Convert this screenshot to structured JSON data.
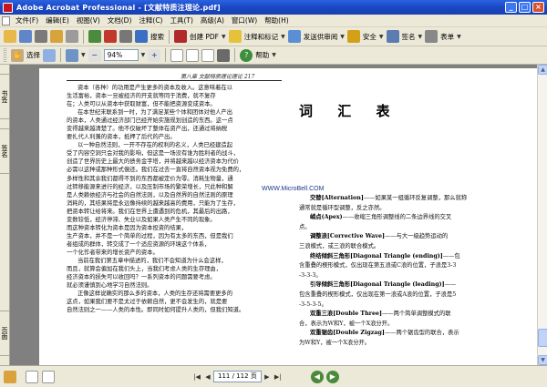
{
  "window": {
    "title": "Adobe Acrobat Professional - [文献特质注理论.pdf]",
    "buttons": [
      "_",
      "□",
      "×"
    ]
  },
  "menu": {
    "items": [
      "文件(F)",
      "编辑(E)",
      "视图(V)",
      "文档(D)",
      "注释(C)",
      "工具(T)",
      "高级(A)",
      "窗口(W)",
      "帮助(H)"
    ]
  },
  "toolbar1": {
    "search_label": "搜索",
    "create_pdf_label": "创建 PDF",
    "review_label": "注释和标记",
    "send_review_label": "发送供审阅",
    "secure_label": "安全",
    "sign_label": "签名",
    "forms_label": "表单"
  },
  "toolbar2": {
    "select_label": "选择",
    "zoom_value": "94%",
    "help_label": "帮助"
  },
  "left_tabs": [
    "书签",
    "签名",
    "页面"
  ],
  "page": {
    "running_head": "第八章  文献特质理论理论  217",
    "left_column": [
      {
        "text": "资本（各种）的功用是产生更多的资本及收入。这意味着在以",
        "indent": true
      },
      {
        "text": "生活富裕，资本一旦被经济的开支就等同于消费，就不复存",
        "indent": false
      },
      {
        "text": "在；人类可以从资本中获取财富，但不能把资源变成资本。",
        "indent": false
      },
      {
        "text": "在本世纪末联系到一时，为了满足某些个体和团体对他人产出",
        "indent": true
      },
      {
        "text": "的资本，人类通过经济部门已经开始实施规划创造的东西。这一点",
        "indent": false
      },
      {
        "text": "变得越来越清楚了。他不仅破坏了整体在资产出，还通过将纳税",
        "indent": false
      },
      {
        "text": "要扎代人利兼的资本，抵押了后代的产出。",
        "indent": false
      },
      {
        "text": "以一种自然法则，一开不存在的权利的名义，人类已经建造起",
        "indent": true
      },
      {
        "text": "受了内容空洞只会对我的影响，但这是一场没有谁为胜利者的战斗，",
        "indent": false
      },
      {
        "text": "创造了世界历史上最大的债务金字塔，并将越来越以经济资本为代价",
        "indent": false
      },
      {
        "text": "必需以这种或那种形式偿还。我们在过去一直将自然资本视为免费的，",
        "indent": false
      },
      {
        "text": "多样性和其余我们都得不到的东西都被定价为零。消耗生物量，通",
        "indent": false
      },
      {
        "text": "过转移能源来进行的经济，以及压制市场的繁荣增长，只此种和解",
        "indent": false
      },
      {
        "text": "是人类赖依经济与社会的自然法则，以及自然界的自然法则的原理",
        "indent": false
      },
      {
        "text": "消耗的，其结果将是永远像持续的越来越高的费用，只能为了生存，",
        "indent": false
      },
      {
        "text": "把资本转让给将来。我们在世界上遭遇到的危机，其最后的出路，",
        "indent": false
      },
      {
        "text": "变数较低，经济停滞、失业以及如果人类产生不同的现象。",
        "indent": false
      },
      {
        "text": "而这种资本转化为资本是因为资本投资的结果，",
        "indent": false
      },
      {
        "text": "生产资本，并不是一个简单的过程，因为有太多的东西，但是我们",
        "indent": false
      },
      {
        "text": "者组成的群体，转交成了一个适应资源的环境这个体系，",
        "indent": false
      },
      {
        "text": "一个化作者带来的增长资产的资本。",
        "indent": false
      },
      {
        "text": "当前在我们第五章中描述的，我们不会知道为什么会这样，",
        "indent": true
      },
      {
        "text": "而且，就算会偏加在我们头上，当我们考虑人类的生存理由，",
        "indent": false
      },
      {
        "text": "经济资本的损失可以收回吗？一系列资本的问题需要考虑。",
        "indent": false
      },
      {
        "text": "就必须谨慎到心地学习自然法则。",
        "indent": false
      },
      {
        "text": "正像这样说确实的那么多的资本，人类的生存还将需要更多的",
        "indent": true
      },
      {
        "text": "这点，如果我们要不是太过于依赖自然，更不会发生的，就是要",
        "indent": false
      },
      {
        "text": "自然法则之一——人类的本性。即同时如何提升人类的，但我们知道。",
        "indent": false
      }
    ],
    "watermark": "WWW.MicroBell.COM",
    "glossary_title": "词 汇 表",
    "glossary": [
      {
        "term": "交替[Alternation]",
        "def": "——如果某一组循环反复调整，那么就称",
        "indent": true
      },
      {
        "term": "",
        "def": "通常就是循环型调整，反之亦然。",
        "indent": false
      },
      {
        "term": "峭点(Apex)",
        "def": "——收缩三角形调整线的二条边界线的交叉",
        "indent": true
      },
      {
        "term": "",
        "def": "点。",
        "indent": false
      },
      {
        "term": "调整浪[Corrective Wave]",
        "def": "——与大一级趋势运动的",
        "indent": true
      },
      {
        "term": "",
        "def": "三浪模式，或三浪的联合模式。",
        "indent": false
      },
      {
        "term": "终结倾斜三角形[Diagonal Triangle (ending)]",
        "def": "——包",
        "indent": true
      },
      {
        "term": "",
        "def": "含重叠的楔形模式，仅出现在第五浪或C浪的位置，子浪是3-3",
        "indent": false
      },
      {
        "term": "",
        "def": "-3-3-3。",
        "indent": false
      },
      {
        "term": "引导倾斜三角形[Diagonal Triangle (leading)]",
        "def": "——",
        "indent": true
      },
      {
        "term": "",
        "def": "包含重叠的楔形模式，仅出现在第一浪或A浪的位置，子浪是5",
        "indent": false
      },
      {
        "term": "",
        "def": "-3-5-3-5。",
        "indent": false
      },
      {
        "term": "双重三浪[Double Three]",
        "def": "——两个简单调整模式的联",
        "indent": true
      },
      {
        "term": "",
        "def": "合，表示为W和Y，被一个X浪分开。",
        "indent": false
      },
      {
        "term": "双重锯齿[Double Zigzag]",
        "def": "——两个锯齿型的联合，表示",
        "indent": true
      },
      {
        "term": "",
        "def": "为W和Y，被一个X浪分开。",
        "indent": false
      }
    ]
  },
  "statusbar": {
    "page_indicator": "111 / 112 页",
    "nav_first": "|◀",
    "nav_prev": "◀",
    "nav_next": "▶",
    "nav_last": "▶|"
  }
}
